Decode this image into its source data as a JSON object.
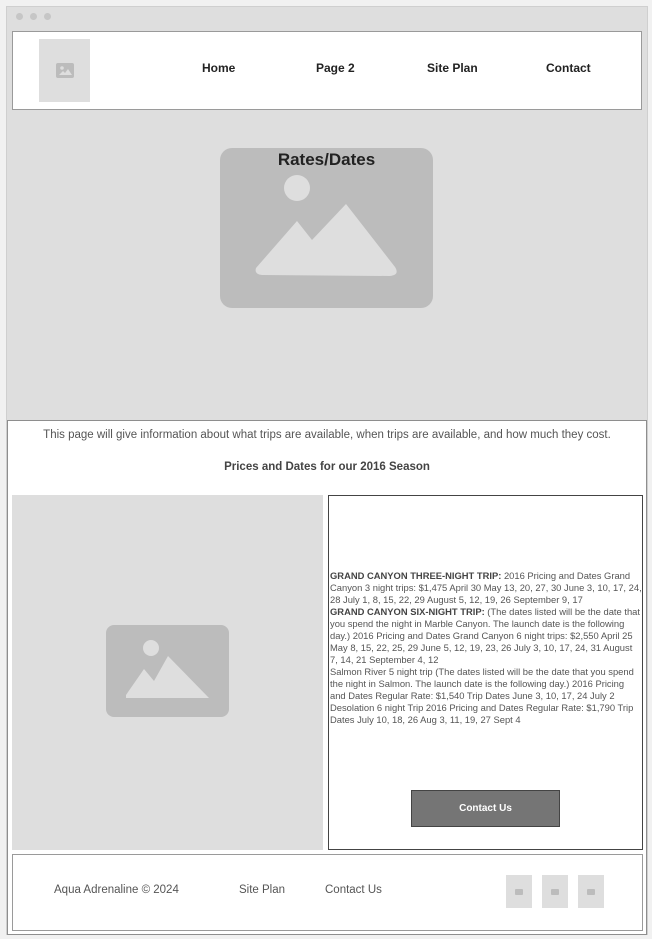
{
  "nav": {
    "items": [
      {
        "label": "Home"
      },
      {
        "label": "Page 2"
      },
      {
        "label": "Site Plan"
      },
      {
        "label": "Contact"
      }
    ]
  },
  "hero": {
    "title": "Rates/Dates"
  },
  "content": {
    "intro": "This page will give information about what trips are available, when trips are available, and how much they cost.",
    "subhead": "Prices and Dates for our 2016 Season",
    "trips": [
      {
        "heading": "GRAND CANYON THREE-NIGHT TRIP:",
        "text": " 2016 Pricing and Dates Grand Canyon 3 night trips: $1,475 April 30 May 13, 20, 27, 30 June 3, 10, 17, 24, 28 July 1, 8, 15, 22, 29 August 5, 12, 19, 26 September 9, 17"
      },
      {
        "heading": "GRAND CANYON SIX-NIGHT TRIP:",
        "text": " (The dates listed will be the date that you spend the night in Marble Canyon. The launch date is the following day.) 2016 Pricing and Dates Grand Canyon 6 night trips: $2,550 April 25 May 8, 15, 22, 25, 29 June 5, 12, 19, 23, 26 July 3, 10, 17, 24, 31 August 7, 14, 21 September 4, 12"
      },
      {
        "heading": "",
        "text": "Salmon River 5 night trip (The dates listed will be the date that you spend the night in Salmon. The launch date is the following day.) 2016 Pricing and Dates Regular Rate: $1,540 Trip Dates June 3, 10, 17, 24 July 2"
      },
      {
        "heading": "",
        "text": "Desolation 6 night Trip 2016 Pricing and Dates Regular Rate: $1,790 Trip Dates July 10, 18, 26 Aug 3, 11, 19, 27 Sept 4"
      }
    ],
    "button_label": "Contact Us"
  },
  "footer": {
    "copyright": "Aqua Adrenaline © 2024",
    "links": [
      "Site Plan",
      "Contact Us"
    ],
    "social_icons": [
      "image-icon",
      "image-icon",
      "image-icon"
    ]
  },
  "colors": {
    "placeholder_bg": "#dedede",
    "placeholder_shape": "#bcbcbc",
    "button_bg": "#757575"
  }
}
